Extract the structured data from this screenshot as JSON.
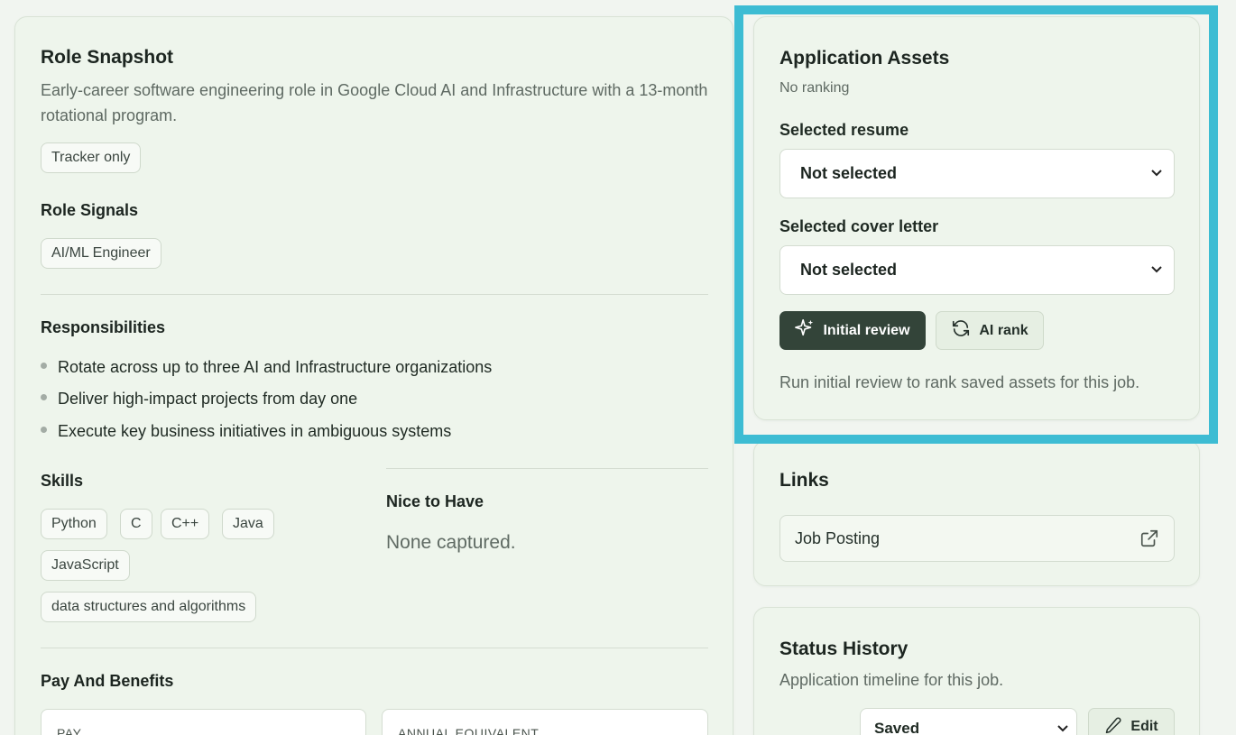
{
  "role_snapshot": {
    "title": "Role Snapshot",
    "description": "Early-career software engineering role in Google Cloud AI and Infrastructure with a 13-month rotational program.",
    "tag": "Tracker only"
  },
  "role_signals": {
    "title": "Role Signals",
    "tags": [
      "AI/ML Engineer"
    ]
  },
  "responsibilities": {
    "title": "Responsibilities",
    "items": [
      "Rotate across up to three AI and Infrastructure organizations",
      "Deliver high-impact projects from day one",
      "Execute key business initiatives in ambiguous systems"
    ]
  },
  "skills": {
    "title": "Skills",
    "items": [
      "Python",
      "C",
      "C++",
      "Java",
      "JavaScript",
      "data structures and algorithms"
    ]
  },
  "nice_to_have": {
    "title": "Nice to Have",
    "empty_text": "None captured."
  },
  "pay": {
    "title": "Pay And Benefits",
    "pay_label": "PAY",
    "annual_label": "ANNUAL EQUIVALENT"
  },
  "assets": {
    "title": "Application Assets",
    "ranking": "No ranking",
    "resume_label": "Selected resume",
    "resume_value": "Not selected",
    "cover_label": "Selected cover letter",
    "cover_value": "Not selected",
    "initial_review_label": "Initial review",
    "ai_rank_label": "AI rank",
    "hint": "Run initial review to rank saved assets for this job."
  },
  "links": {
    "title": "Links",
    "job_posting": "Job Posting"
  },
  "status_history": {
    "title": "Status History",
    "subtitle": "Application timeline for this job.",
    "status_value": "Saved",
    "edit_label": "Edit"
  },
  "colors": {
    "highlight": "#3dbcd3",
    "primary_button": "#334439",
    "card_background": "#eef5ec"
  }
}
